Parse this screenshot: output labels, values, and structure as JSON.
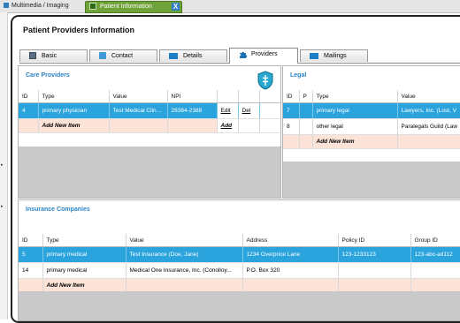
{
  "window": {
    "tabs": [
      {
        "label": "Multimedia / Imaging"
      },
      {
        "label": "Patient Information",
        "close": "X"
      }
    ]
  },
  "page": {
    "title": "Patient Providers Information"
  },
  "subtabs": [
    {
      "label": "Basic"
    },
    {
      "label": "Contact"
    },
    {
      "label": "Details"
    },
    {
      "label": "Providers",
      "active": true
    },
    {
      "label": "Mailings"
    }
  ],
  "care": {
    "title": "Care Providers",
    "columns": [
      "ID",
      "Type",
      "Value",
      "NPI"
    ],
    "rows": [
      {
        "id": "4",
        "type": "primary physician",
        "value": "Test Medical Clinic...",
        "npi": "28384-2388",
        "edit": "Edit",
        "del": "Del"
      }
    ],
    "add": {
      "label": "Add New Item",
      "action": "Add"
    }
  },
  "legal": {
    "title": "Legal",
    "columns": [
      "ID",
      "P",
      "Type",
      "Value"
    ],
    "rows": [
      {
        "id": "7",
        "p": "",
        "type": "primary legal",
        "value": "Lawyers, Inc. (Lost, V"
      },
      {
        "id": "8",
        "p": "",
        "type": "other legal",
        "value": "Paralegals Guild (Law"
      }
    ],
    "add": {
      "label": "Add New Item"
    }
  },
  "insurance": {
    "title": "Insurance Companies",
    "columns": [
      "ID",
      "Type",
      "Value",
      "Address",
      "Policy ID",
      "Group ID"
    ],
    "rows": [
      {
        "id": "5",
        "type": "primary medical",
        "value": "Test Insurance (Doe, Jane)",
        "address": "1234 Overprice Lane",
        "policy": "123-1233123",
        "group": "123-abc-ad112"
      },
      {
        "id": "14",
        "type": "primary medical",
        "value": "Medical One Insurance, Inc. (Conolloy...",
        "address": "P.O. Box 320",
        "policy": "",
        "group": ""
      }
    ],
    "add": {
      "label": "Add New Item"
    }
  },
  "colors": {
    "accent": "#2b84c6",
    "selection": "#2ba3dc",
    "add_row": "#fbe3d7",
    "active_window_tab": "#6fa238"
  }
}
